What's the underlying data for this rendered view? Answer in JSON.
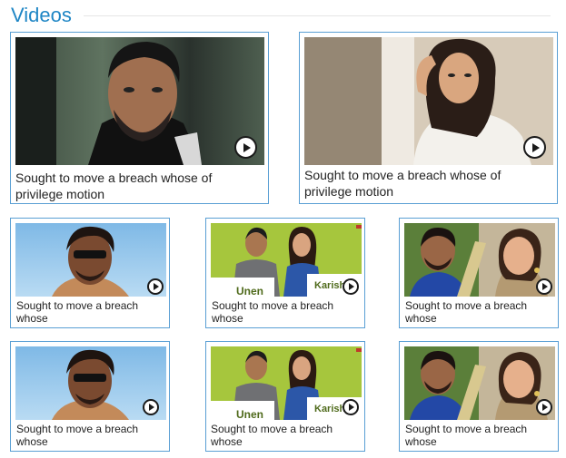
{
  "section": {
    "title": "Videos"
  },
  "featured": [
    {
      "caption": "Sought to move a breach whose  of privilege motion",
      "thumbnail": "man-dark-jacket-portrait",
      "play_icon": "play-circle-icon"
    },
    {
      "caption": "Sought to move a breach whose  of privilege motion",
      "thumbnail": "woman-white-shirt-portrait",
      "play_icon": "play-circle-icon"
    }
  ],
  "grid": [
    {
      "caption": "Sought to move a breach whose",
      "thumbnail": "man-sunglasses-sky",
      "play_icon": "play-circle-icon"
    },
    {
      "caption": "Sought to move a breach whose",
      "thumbnail": "couple-placard-green",
      "placard_left": "Unen",
      "placard_right": "Karish",
      "play_icon": "play-circle-icon"
    },
    {
      "caption": "Sought to move a breach whose",
      "thumbnail": "cricketer-and-woman",
      "play_icon": "play-circle-icon"
    },
    {
      "caption": "Sought to move a breach whose",
      "thumbnail": "man-sunglasses-sky",
      "play_icon": "play-circle-icon"
    },
    {
      "caption": "Sought to move a breach whose",
      "thumbnail": "couple-placard-green",
      "placard_left": "Unen",
      "placard_right": "Karish",
      "play_icon": "play-circle-icon"
    },
    {
      "caption": "Sought to move a breach whose",
      "thumbnail": "cricketer-and-woman",
      "play_icon": "play-circle-icon"
    }
  ],
  "colors": {
    "accent": "#1f86c5",
    "card_border": "#5a9fd4",
    "text": "#222222"
  }
}
